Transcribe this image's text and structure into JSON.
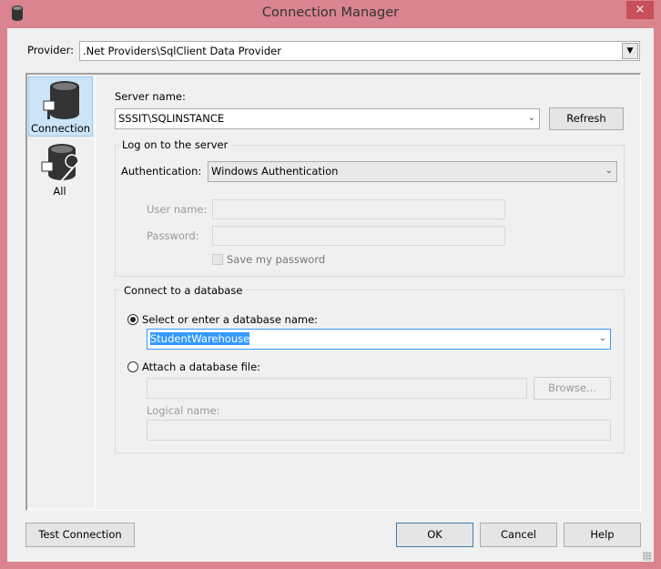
{
  "window": {
    "title": "Connection Manager",
    "close_glyph": "×"
  },
  "provider": {
    "label": "Provider:",
    "value": ".Net Providers\\SqlClient Data Provider"
  },
  "sidebar": {
    "items": [
      {
        "label": "Connection",
        "icon": "database-plug-icon",
        "selected": true
      },
      {
        "label": "All",
        "icon": "database-wrench-icon",
        "selected": false
      }
    ]
  },
  "server": {
    "label": "Server name:",
    "value": "SSSIT\\SQLINSTANCE",
    "refresh": "Refresh"
  },
  "logon": {
    "legend": "Log on to the server",
    "auth_label": "Authentication:",
    "auth_value": "Windows Authentication",
    "user_label": "User name:",
    "user_value": "",
    "password_label": "Password:",
    "password_value": "",
    "save_password": "Save my password",
    "save_checked": false
  },
  "database": {
    "legend": "Connect to a database",
    "select_label": "Select or enter a database name:",
    "select_checked": true,
    "db_name": "StudentWarehouse",
    "attach_label": "Attach a database file:",
    "attach_checked": false,
    "file_value": "",
    "browse": "Browse...",
    "logical_label": "Logical name:",
    "logical_value": ""
  },
  "footer": {
    "test": "Test Connection",
    "ok": "OK",
    "cancel": "Cancel",
    "help": "Help"
  },
  "colors": {
    "frame": "#d9848e",
    "selection": "#3399ff",
    "sidebar_selected": "#cce4f7"
  }
}
